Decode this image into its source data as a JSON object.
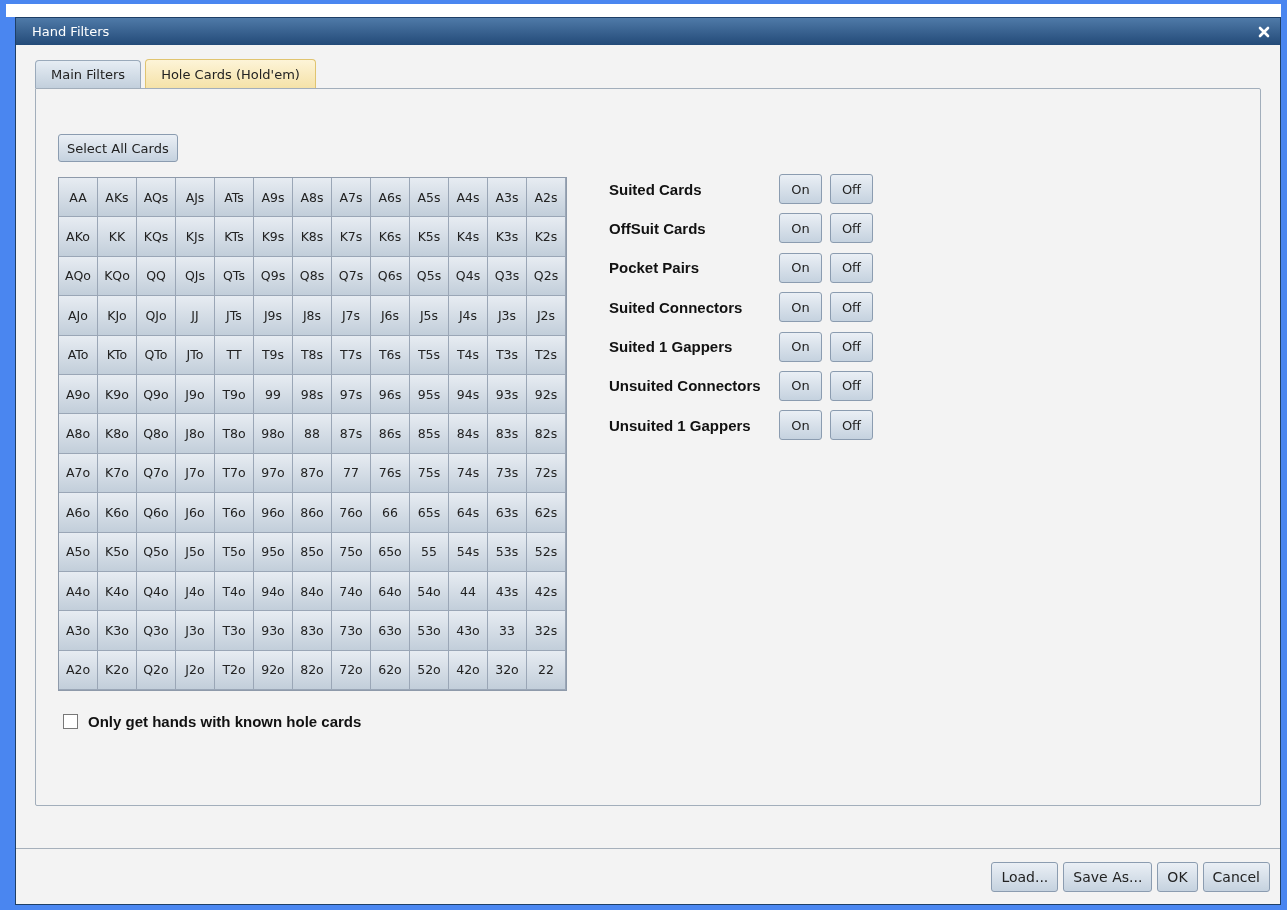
{
  "window": {
    "title": "Hand Filters"
  },
  "tabs": [
    {
      "label": "Main Filters",
      "selected": false
    },
    {
      "label": "Hole Cards (Hold'em)",
      "selected": true
    }
  ],
  "select_all_button": "Select All Cards",
  "grid": [
    [
      {
        "label": "AA",
        "selected": false
      },
      {
        "label": "AKs",
        "selected": false
      },
      {
        "label": "AQs",
        "selected": false
      },
      {
        "label": "AJs",
        "selected": false
      },
      {
        "label": "ATs",
        "selected": false
      },
      {
        "label": "A9s",
        "selected": false
      },
      {
        "label": "A8s",
        "selected": false
      },
      {
        "label": "A7s",
        "selected": false
      },
      {
        "label": "A6s",
        "selected": false
      },
      {
        "label": "A5s",
        "selected": false
      },
      {
        "label": "A4s",
        "selected": false
      },
      {
        "label": "A3s",
        "selected": false
      },
      {
        "label": "A2s",
        "selected": false
      }
    ],
    [
      {
        "label": "AKo",
        "selected": false
      },
      {
        "label": "KK",
        "selected": false
      },
      {
        "label": "KQs",
        "selected": false
      },
      {
        "label": "KJs",
        "selected": false
      },
      {
        "label": "KTs",
        "selected": false
      },
      {
        "label": "K9s",
        "selected": false
      },
      {
        "label": "K8s",
        "selected": false
      },
      {
        "label": "K7s",
        "selected": false
      },
      {
        "label": "K6s",
        "selected": false
      },
      {
        "label": "K5s",
        "selected": false
      },
      {
        "label": "K4s",
        "selected": false
      },
      {
        "label": "K3s",
        "selected": false
      },
      {
        "label": "K2s",
        "selected": false
      }
    ],
    [
      {
        "label": "AQo",
        "selected": false
      },
      {
        "label": "KQo",
        "selected": false
      },
      {
        "label": "QQ",
        "selected": false
      },
      {
        "label": "QJs",
        "selected": false
      },
      {
        "label": "QTs",
        "selected": false
      },
      {
        "label": "Q9s",
        "selected": false
      },
      {
        "label": "Q8s",
        "selected": false
      },
      {
        "label": "Q7s",
        "selected": false
      },
      {
        "label": "Q6s",
        "selected": false
      },
      {
        "label": "Q5s",
        "selected": false
      },
      {
        "label": "Q4s",
        "selected": false
      },
      {
        "label": "Q3s",
        "selected": false
      },
      {
        "label": "Q2s",
        "selected": false
      }
    ],
    [
      {
        "label": "AJo",
        "selected": false
      },
      {
        "label": "KJo",
        "selected": false
      },
      {
        "label": "QJo",
        "selected": false
      },
      {
        "label": "JJ",
        "selected": false
      },
      {
        "label": "JTs",
        "selected": false
      },
      {
        "label": "J9s",
        "selected": false
      },
      {
        "label": "J8s",
        "selected": false
      },
      {
        "label": "J7s",
        "selected": false
      },
      {
        "label": "J6s",
        "selected": false
      },
      {
        "label": "J5s",
        "selected": false
      },
      {
        "label": "J4s",
        "selected": false
      },
      {
        "label": "J3s",
        "selected": false
      },
      {
        "label": "J2s",
        "selected": false
      }
    ],
    [
      {
        "label": "ATo",
        "selected": false
      },
      {
        "label": "KTo",
        "selected": false
      },
      {
        "label": "QTo",
        "selected": false
      },
      {
        "label": "JTo",
        "selected": false
      },
      {
        "label": "TT",
        "selected": false
      },
      {
        "label": "T9s",
        "selected": false
      },
      {
        "label": "T8s",
        "selected": false
      },
      {
        "label": "T7s",
        "selected": false
      },
      {
        "label": "T6s",
        "selected": false
      },
      {
        "label": "T5s",
        "selected": false
      },
      {
        "label": "T4s",
        "selected": false
      },
      {
        "label": "T3s",
        "selected": false
      },
      {
        "label": "T2s",
        "selected": false
      }
    ],
    [
      {
        "label": "A9o",
        "selected": false
      },
      {
        "label": "K9o",
        "selected": false
      },
      {
        "label": "Q9o",
        "selected": false
      },
      {
        "label": "J9o",
        "selected": false
      },
      {
        "label": "T9o",
        "selected": false
      },
      {
        "label": "99",
        "selected": false
      },
      {
        "label": "98s",
        "selected": false
      },
      {
        "label": "97s",
        "selected": false
      },
      {
        "label": "96s",
        "selected": false
      },
      {
        "label": "95s",
        "selected": false
      },
      {
        "label": "94s",
        "selected": false
      },
      {
        "label": "93s",
        "selected": false
      },
      {
        "label": "92s",
        "selected": false
      }
    ],
    [
      {
        "label": "A8o",
        "selected": false
      },
      {
        "label": "K8o",
        "selected": false
      },
      {
        "label": "Q8o",
        "selected": false
      },
      {
        "label": "J8o",
        "selected": false
      },
      {
        "label": "T8o",
        "selected": false
      },
      {
        "label": "98o",
        "selected": false
      },
      {
        "label": "88",
        "selected": false
      },
      {
        "label": "87s",
        "selected": false
      },
      {
        "label": "86s",
        "selected": false
      },
      {
        "label": "85s",
        "selected": false
      },
      {
        "label": "84s",
        "selected": false
      },
      {
        "label": "83s",
        "selected": false
      },
      {
        "label": "82s",
        "selected": false
      }
    ],
    [
      {
        "label": "A7o",
        "selected": false
      },
      {
        "label": "K7o",
        "selected": false
      },
      {
        "label": "Q7o",
        "selected": false
      },
      {
        "label": "J7o",
        "selected": false
      },
      {
        "label": "T7o",
        "selected": false
      },
      {
        "label": "97o",
        "selected": false
      },
      {
        "label": "87o",
        "selected": false
      },
      {
        "label": "77",
        "selected": false
      },
      {
        "label": "76s",
        "selected": false
      },
      {
        "label": "75s",
        "selected": false
      },
      {
        "label": "74s",
        "selected": false
      },
      {
        "label": "73s",
        "selected": false
      },
      {
        "label": "72s",
        "selected": false
      }
    ],
    [
      {
        "label": "A6o",
        "selected": false
      },
      {
        "label": "K6o",
        "selected": false
      },
      {
        "label": "Q6o",
        "selected": false
      },
      {
        "label": "J6o",
        "selected": false
      },
      {
        "label": "T6o",
        "selected": false
      },
      {
        "label": "96o",
        "selected": false
      },
      {
        "label": "86o",
        "selected": false
      },
      {
        "label": "76o",
        "selected": false
      },
      {
        "label": "66",
        "selected": false
      },
      {
        "label": "65s",
        "selected": false
      },
      {
        "label": "64s",
        "selected": false
      },
      {
        "label": "63s",
        "selected": false
      },
      {
        "label": "62s",
        "selected": false
      }
    ],
    [
      {
        "label": "A5o",
        "selected": false
      },
      {
        "label": "K5o",
        "selected": false
      },
      {
        "label": "Q5o",
        "selected": false
      },
      {
        "label": "J5o",
        "selected": false
      },
      {
        "label": "T5o",
        "selected": false
      },
      {
        "label": "95o",
        "selected": false
      },
      {
        "label": "85o",
        "selected": false
      },
      {
        "label": "75o",
        "selected": false
      },
      {
        "label": "65o",
        "selected": false
      },
      {
        "label": "55",
        "selected": false
      },
      {
        "label": "54s",
        "selected": false
      },
      {
        "label": "53s",
        "selected": false
      },
      {
        "label": "52s",
        "selected": false
      }
    ],
    [
      {
        "label": "A4o",
        "selected": false
      },
      {
        "label": "K4o",
        "selected": false
      },
      {
        "label": "Q4o",
        "selected": false
      },
      {
        "label": "J4o",
        "selected": false
      },
      {
        "label": "T4o",
        "selected": false
      },
      {
        "label": "94o",
        "selected": false
      },
      {
        "label": "84o",
        "selected": false
      },
      {
        "label": "74o",
        "selected": false
      },
      {
        "label": "64o",
        "selected": false
      },
      {
        "label": "54o",
        "selected": false
      },
      {
        "label": "44",
        "selected": false
      },
      {
        "label": "43s",
        "selected": false
      },
      {
        "label": "42s",
        "selected": false
      }
    ],
    [
      {
        "label": "A3o",
        "selected": false
      },
      {
        "label": "K3o",
        "selected": false
      },
      {
        "label": "Q3o",
        "selected": false
      },
      {
        "label": "J3o",
        "selected": false
      },
      {
        "label": "T3o",
        "selected": false
      },
      {
        "label": "93o",
        "selected": false
      },
      {
        "label": "83o",
        "selected": false
      },
      {
        "label": "73o",
        "selected": false
      },
      {
        "label": "63o",
        "selected": false
      },
      {
        "label": "53o",
        "selected": false
      },
      {
        "label": "43o",
        "selected": false
      },
      {
        "label": "33",
        "selected": false
      },
      {
        "label": "32s",
        "selected": false
      }
    ],
    [
      {
        "label": "A2o",
        "selected": false
      },
      {
        "label": "K2o",
        "selected": false
      },
      {
        "label": "Q2o",
        "selected": false
      },
      {
        "label": "J2o",
        "selected": false
      },
      {
        "label": "T2o",
        "selected": false
      },
      {
        "label": "92o",
        "selected": false
      },
      {
        "label": "82o",
        "selected": false
      },
      {
        "label": "72o",
        "selected": false
      },
      {
        "label": "62o",
        "selected": false
      },
      {
        "label": "52o",
        "selected": false
      },
      {
        "label": "42o",
        "selected": false
      },
      {
        "label": "32o",
        "selected": false
      },
      {
        "label": "22",
        "selected": false
      }
    ]
  ],
  "groups": [
    {
      "label": "Suited Cards",
      "on": "On",
      "off": "Off"
    },
    {
      "label": "OffSuit Cards",
      "on": "On",
      "off": "Off"
    },
    {
      "label": "Pocket Pairs",
      "on": "On",
      "off": "Off"
    },
    {
      "label": "Suited Connectors",
      "on": "On",
      "off": "Off"
    },
    {
      "label": "Suited 1 Gappers",
      "on": "On",
      "off": "Off"
    },
    {
      "label": "Unsuited Connectors",
      "on": "On",
      "off": "Off"
    },
    {
      "label": "Unsuited 1 Gappers",
      "on": "On",
      "off": "Off"
    }
  ],
  "known_hole_cards": {
    "label": "Only get hands with known hole cards",
    "checked": false
  },
  "buttons": [
    "Load...",
    "Save As...",
    "OK",
    "Cancel"
  ]
}
